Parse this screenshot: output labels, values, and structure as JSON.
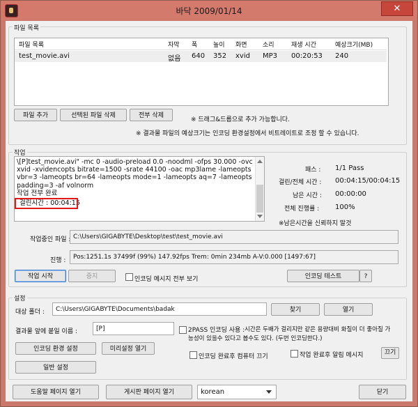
{
  "window": {
    "title": "바닥 2009/01/14",
    "close": "✕"
  },
  "file_list": {
    "group_label": "파일 목록",
    "columns": [
      "파일 목록",
      "자막",
      "폭",
      "높이",
      "화면",
      "소리",
      "재생 시간",
      "예상크기(MB)"
    ],
    "rows": [
      [
        "test_movie.avi",
        "없음",
        "640",
        "352",
        "xvid",
        "MP3",
        "00:20:53",
        "240"
      ]
    ],
    "add_file": "파일 추가",
    "delete_selected": "선택된 파일 삭제",
    "delete_all": "전부 삭제",
    "drag_hint": "※ 드래그&드롭으로 추가 가능합니다.",
    "size_hint": "※ 결과물 파일의 예상크기는 인코딩 환경설정에서 비트레이트로 조정 할 수 있습니다."
  },
  "job": {
    "group_label": "작업",
    "log_lines": "\\[P]test_movie.avi\" -mc 0 -audio-preload 0.0 -noodml -ofps 30.000 -ovc xvid -xvidencopts bitrate=1500 -srate 44100 -oac mp3lame -lameopts vbr=3 -lameopts br=64 -lameopts mode=1 -lameopts aq=7 -lameopts padding=3 -af volnorm\n작업 전부 완료",
    "elapsed_line": "걸린시간 : 00:04:15",
    "pass_label": "패스 :",
    "pass_value": "1/1 Pass",
    "elapsed_total_label": "걸린/전체 시간 :",
    "elapsed_total_value": "00:04:15/00:04:15",
    "remaining_label": "남은 시간 :",
    "remaining_value": "00:00:00",
    "progress_label": "전체 진행률 :",
    "progress_value": "100%",
    "remaining_note": "※남은시간을 신뢰하지 말것",
    "current_file_label": "작업중인 파일 :",
    "current_file_value": "C:\\Users\\GIGABYTE\\Desktop\\test\\test_movie.avi",
    "progress_row_label": "진행 :",
    "progress_row_value": "Pos:1251.1s  37499f (99%) 147.92fps Trem:    0min 234mb  A-V:0.000 [1497:67]",
    "start": "작업 시작",
    "stop": "중지",
    "show_all_messages": "인코딩 메시지 전부 보기",
    "encoding_test": "인코딩 테스트",
    "help": "?"
  },
  "settings": {
    "group_label": "설정",
    "target_folder_label": "대상 폴더 :",
    "target_folder_value": "C:\\Users\\GIGABYTE\\Documents\\badak",
    "browse": "찾기",
    "open": "열기",
    "prefix_label": "결과물 앞에 붙일 이름 :",
    "prefix_value": "[P]",
    "twopass_label": "2PASS 인코딩 사용 :",
    "twopass_desc_1": "시간은 두배가 걸리지만 같은 용량대비 화질이 더 좋아질 가",
    "twopass_desc_2": "능성이 있을수 있다고 봅수도 있다. (두번 인코딩한다.)",
    "encoding_settings": "인코딩 환경 설정",
    "open_preset": "미리설정 열기",
    "general_settings": "일반 설정",
    "shutdown_after": "인코딩 완료후 컴퓨터 끄기",
    "notify_after": "작업 완료후 알림 메시지",
    "close_small": "끄기"
  },
  "footer": {
    "help_page": "도움말 페이지 열기",
    "board_page": "게시판 페이지 열기",
    "language": "korean",
    "close": "닫기"
  }
}
